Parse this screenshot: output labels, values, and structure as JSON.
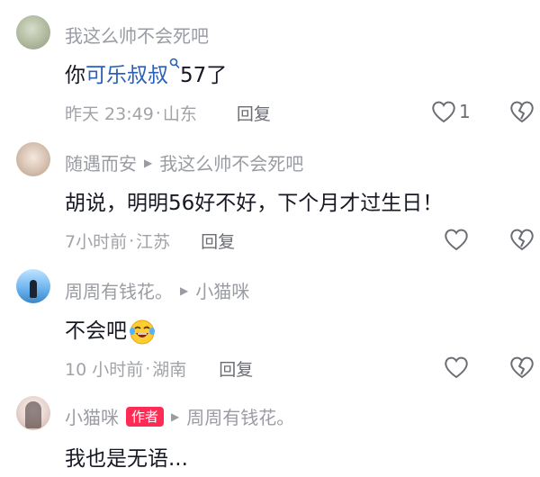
{
  "comments": [
    {
      "username": "我这么帅不会死吧",
      "text_prefix": "你",
      "text_link": "可乐叔叔",
      "text_suffix": "57了",
      "time": "昨天 23:49",
      "location": "山东",
      "reply_label": "回复",
      "like_count": "1"
    },
    {
      "username": "随遇而安",
      "reply_to": "我这么帅不会死吧",
      "text": "胡说，明明56好不好，下个月才过生日！",
      "time": "7小时前",
      "location": "江苏",
      "reply_label": "回复"
    },
    {
      "username": "周周有钱花。",
      "reply_to": "小猫咪",
      "text": "不会吧",
      "emoji": "laughing-crying-emoji",
      "time": "10 小时前",
      "location": "湖南",
      "reply_label": "回复"
    },
    {
      "username": "小猫咪",
      "badge": "作者",
      "reply_to": "周周有钱花。",
      "text": "我也是无语..."
    }
  ],
  "separator": "·",
  "colors": {
    "link": "#2b5fb8",
    "muted": "#a1a3a9",
    "badge": "#fe2c55",
    "text": "#161823"
  }
}
